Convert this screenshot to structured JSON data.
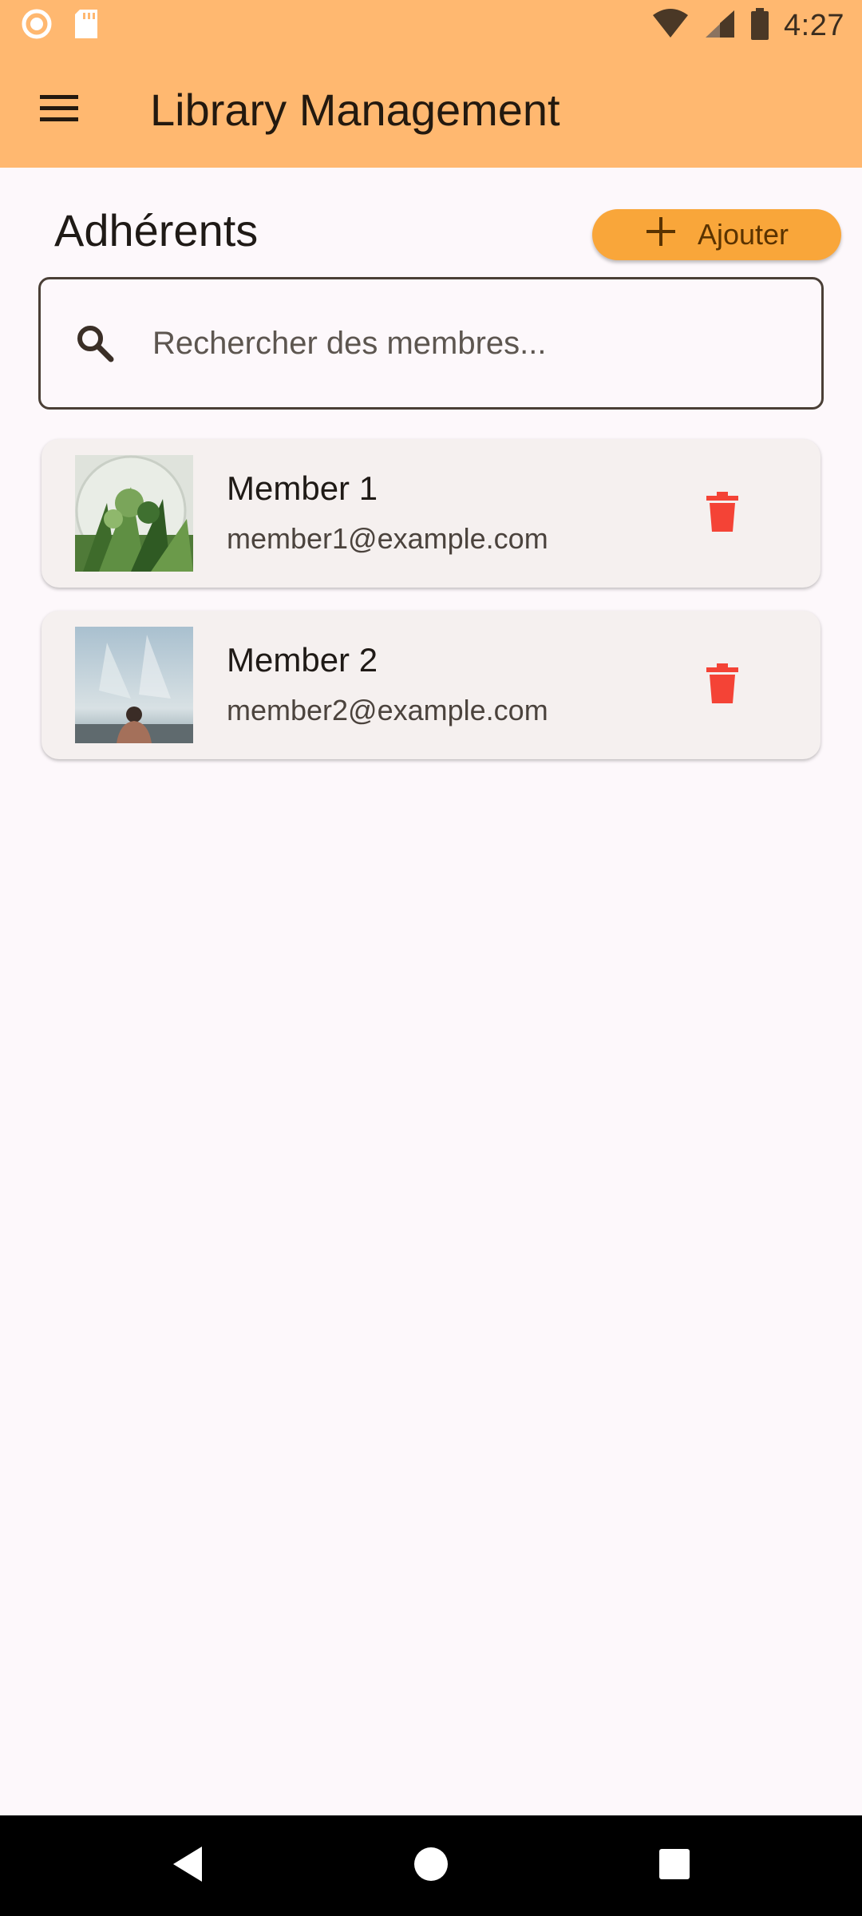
{
  "status_bar": {
    "time": "4:27"
  },
  "app_bar": {
    "title": "Library Management"
  },
  "section": {
    "title": "Adhérents",
    "add_label": "Ajouter"
  },
  "search": {
    "placeholder": "Rechercher des membres...",
    "value": ""
  },
  "members": [
    {
      "name": "Member 1",
      "email": "member1@example.com"
    },
    {
      "name": "Member 2",
      "email": "member2@example.com"
    }
  ],
  "colors": {
    "app_bar": "#ffb870",
    "accent": "#f9a63a",
    "delete": "#f44336",
    "card": "#f5f0ef",
    "background": "#fdf8fb"
  },
  "icons": [
    "menu-icon",
    "search-icon",
    "add-icon",
    "delete-icon",
    "wifi-icon",
    "signal-icon",
    "battery-icon",
    "sd-card-icon",
    "record-icon"
  ]
}
